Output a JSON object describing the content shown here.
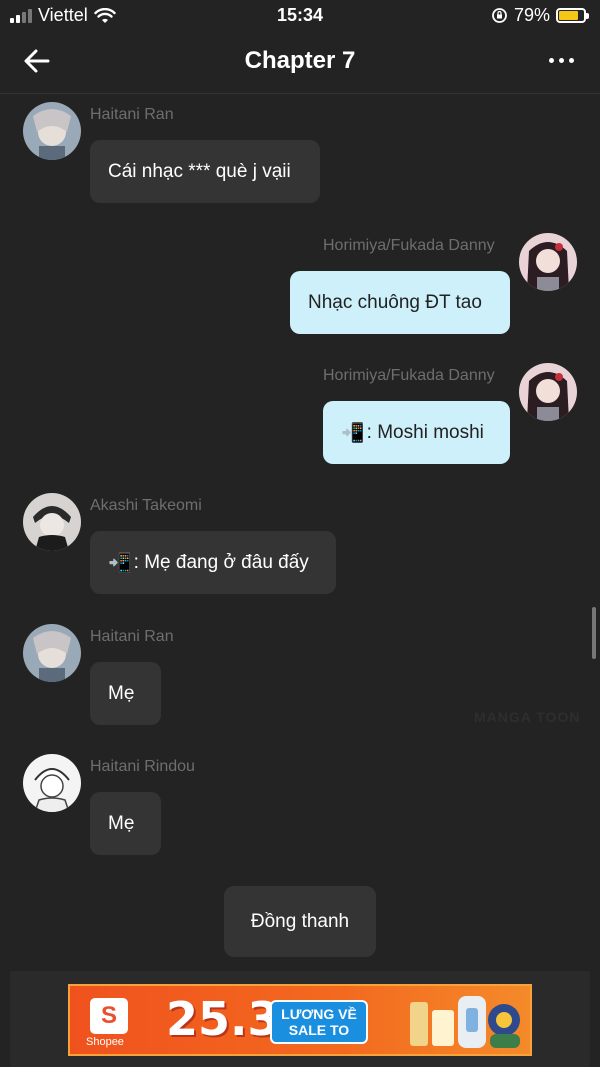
{
  "status_bar": {
    "carrier": "Viettel",
    "time": "15:34",
    "battery": "79%"
  },
  "header": {
    "title": "Chapter 7"
  },
  "messages": [
    {
      "sender": "Haitani Ran",
      "text": "Cái nhạc *** què j vạii",
      "side": "left"
    },
    {
      "sender": "Horimiya/Fukada Danny",
      "text": "Nhạc chuông ĐT tao",
      "side": "right"
    },
    {
      "sender": "Horimiya/Fukada Danny",
      "icon": "📲",
      "text": ": Moshi moshi",
      "side": "right"
    },
    {
      "sender": "Akashi Takeomi",
      "icon": "📲",
      "text": ": Mẹ đang ở đâu đấy",
      "side": "left"
    },
    {
      "sender": "Haitani Ran",
      "text": "Mẹ",
      "side": "left"
    },
    {
      "sender": "Haitani Rindou",
      "text": "Mẹ",
      "side": "left"
    }
  ],
  "narration": "Đồng thanh",
  "watermark": "MANGA TOON",
  "ad": {
    "brand": "Shopee",
    "date": "25.3",
    "sale_line1": "LƯƠNG VỀ",
    "sale_line2": "SALE TO"
  }
}
